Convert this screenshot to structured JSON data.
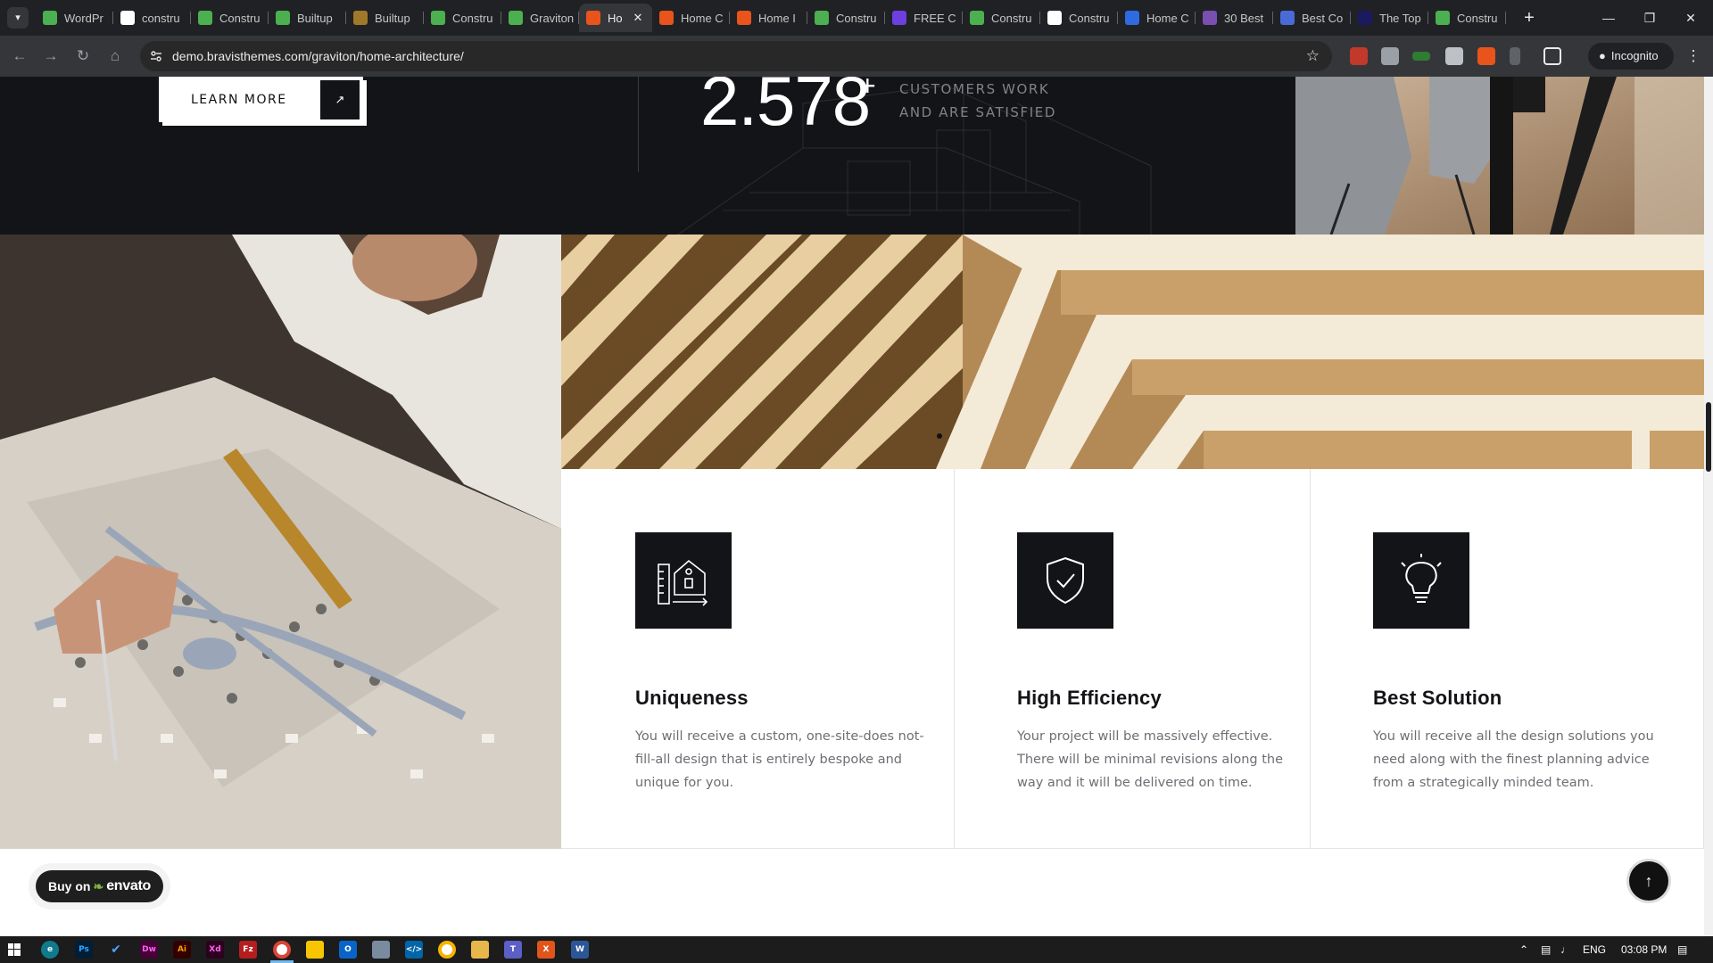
{
  "browser": {
    "tabs": [
      {
        "title": "WordPr",
        "icon": "wordpress-green-icon",
        "color": "#4caf50"
      },
      {
        "title": "constru",
        "icon": "google-icon",
        "color": "#ffffff"
      },
      {
        "title": "Constru",
        "icon": "envato-leaf-icon",
        "color": "#4caf50"
      },
      {
        "title": "Builtup",
        "icon": "envato-leaf-icon",
        "color": "#4caf50"
      },
      {
        "title": "Builtup",
        "icon": "builtup-icon",
        "color": "#a0782a"
      },
      {
        "title": "Constru",
        "icon": "envato-leaf-icon",
        "color": "#4caf50"
      },
      {
        "title": "Graviton",
        "icon": "envato-leaf-icon",
        "color": "#4caf50"
      },
      {
        "title": "Ho",
        "icon": "graviton-icon",
        "color": "#e8541c",
        "active": true
      },
      {
        "title": "Home C",
        "icon": "graviton-icon",
        "color": "#e8541c"
      },
      {
        "title": "Home I",
        "icon": "graviton-icon",
        "color": "#e8541c"
      },
      {
        "title": "Constru",
        "icon": "envato-leaf-icon",
        "color": "#4caf50"
      },
      {
        "title": "FREE C",
        "icon": "astra-icon",
        "color": "#6d3fe0"
      },
      {
        "title": "Constru",
        "icon": "envato-leaf-icon",
        "color": "#4caf50"
      },
      {
        "title": "Constru",
        "icon": "wix-icon",
        "color": "#ffffff"
      },
      {
        "title": "Home C",
        "icon": "website-builder-icon",
        "color": "#2f6ae0"
      },
      {
        "title": "30 Best",
        "icon": "colorlib-icon",
        "color": "#7a4fb0"
      },
      {
        "title": "Best Co",
        "icon": "diamond-icon",
        "color": "#4a6bd6"
      },
      {
        "title": "The Top",
        "icon": "y-icon",
        "color": "#1a1a5e"
      },
      {
        "title": "Constru",
        "icon": "envato-leaf-icon",
        "color": "#4caf50"
      }
    ],
    "url": "demo.bravisthemes.com/graviton/home-architecture/",
    "incognito_label": "Incognito"
  },
  "page": {
    "learn_more": "LEARN MORE",
    "stat_number": "2.578",
    "stat_suffix": "+",
    "stat_caption": "CUSTOMERS WORK AND ARE SATISFIED",
    "features": [
      {
        "title": "Uniqueness",
        "text": "You will receive a custom, one-site-does not-fill-all design that is entirely bespoke and unique for you.",
        "icon": "house-ruler-icon"
      },
      {
        "title": "High Efficiency",
        "text": "Your project will be massively effective. There will be minimal revisions along the way and it will be delivered on time.",
        "icon": "shield-check-icon"
      },
      {
        "title": "Best Solution",
        "text": "You will receive all the design solutions you need along with the finest planning advice from a strategically minded team.",
        "icon": "lightbulb-icon"
      }
    ],
    "envato_prefix": "Buy on",
    "envato_brand": "envato"
  },
  "taskbar": {
    "language": "ENG",
    "time": "03:08 PM"
  },
  "colors": {
    "dark": "#131417",
    "body_text": "#6c6f74",
    "caption": "#7f8287",
    "chrome": "#202124"
  }
}
